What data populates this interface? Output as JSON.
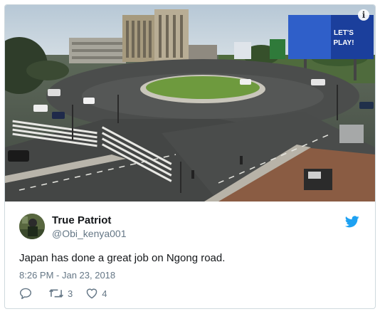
{
  "tweet": {
    "display_name": "True Patriot",
    "handle": "@Obi_kenya001",
    "text": "Japan has done a great job on Ngong road.",
    "timestamp": "8:26 PM - Jan 23, 2018",
    "retweet_count": "3",
    "like_count": "4"
  },
  "media": {
    "billboard_line1": "LET'S",
    "billboard_line2": "PLAY!",
    "info_glyph": "i"
  },
  "icons": {
    "reply": "reply-icon",
    "retweet": "retweet-icon",
    "like": "heart-icon",
    "brand": "twitter-bird-icon"
  },
  "colors": {
    "brand_blue": "#1da1f2",
    "text_primary": "#14171a",
    "text_secondary": "#657786",
    "border": "#cfd9de"
  }
}
